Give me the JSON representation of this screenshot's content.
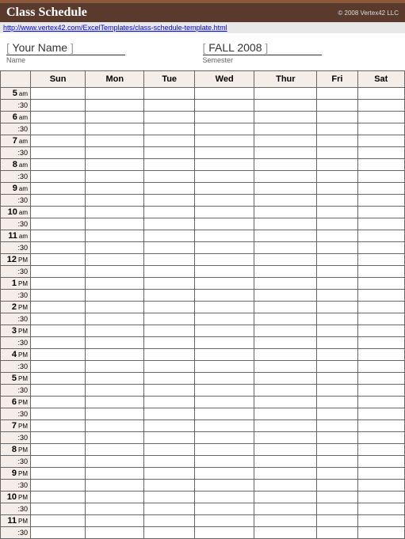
{
  "header": {
    "title": "Class Schedule",
    "copyright": "© 2008 Vertex42 LLC",
    "url": "http://www.vertex42.com/ExcelTemplates/class-schedule-template.html"
  },
  "info": {
    "name_value": "Your Name",
    "name_label": "Name",
    "semester_value": "FALL 2008",
    "semester_label": "Semester"
  },
  "days": [
    "Sun",
    "Mon",
    "Tue",
    "Wed",
    "Thur",
    "Fri",
    "Sat"
  ],
  "time_slots": [
    {
      "hour": "5",
      "period": "am"
    },
    {
      "hour": "6",
      "period": "am"
    },
    {
      "hour": "7",
      "period": "am"
    },
    {
      "hour": "8",
      "period": "am"
    },
    {
      "hour": "9",
      "period": "am"
    },
    {
      "hour": "10",
      "period": "am"
    },
    {
      "hour": "11",
      "period": "am"
    },
    {
      "hour": "12",
      "period": "PM"
    },
    {
      "hour": "1",
      "period": "PM"
    },
    {
      "hour": "2",
      "period": "PM"
    },
    {
      "hour": "3",
      "period": "PM"
    },
    {
      "hour": "4",
      "period": "PM"
    },
    {
      "hour": "5",
      "period": "PM"
    },
    {
      "hour": "6",
      "period": "PM"
    },
    {
      "hour": "7",
      "period": "PM"
    },
    {
      "hour": "8",
      "period": "PM"
    },
    {
      "hour": "9",
      "period": "PM"
    },
    {
      "hour": "10",
      "period": "PM"
    },
    {
      "hour": "11",
      "period": "PM"
    }
  ],
  "half_label": ":30"
}
